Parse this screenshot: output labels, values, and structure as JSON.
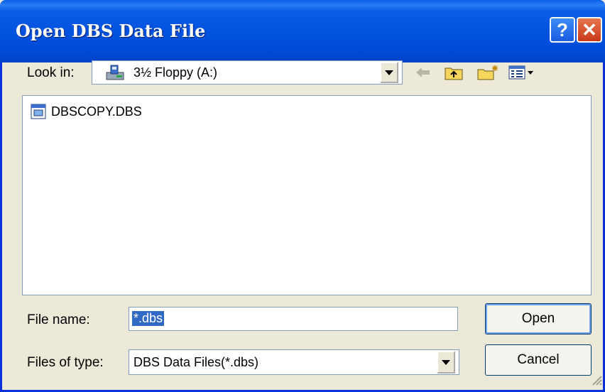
{
  "window": {
    "title": "Open DBS Data File",
    "help_glyph": "?",
    "close_glyph": "✕"
  },
  "look_in": {
    "label": "Look in:",
    "value": "3½ Floppy (A:)"
  },
  "toolbar": {
    "icons": [
      "back-arrow-icon",
      "up-folder-icon",
      "new-folder-icon",
      "view-menu-icon"
    ]
  },
  "files": [
    {
      "name": "DBSCOPY.DBS",
      "icon": "dbs-file-icon"
    }
  ],
  "filename": {
    "label": "File name:",
    "value": "*.dbs"
  },
  "filetype": {
    "label": "Files of type:",
    "value": "DBS Data Files(*.dbs)"
  },
  "buttons": {
    "open": "Open",
    "cancel": "Cancel"
  },
  "colors": {
    "titlebar": "#0054E3",
    "face": "#ECE9D8",
    "selection": "#316AC5",
    "close": "#D8532E"
  }
}
